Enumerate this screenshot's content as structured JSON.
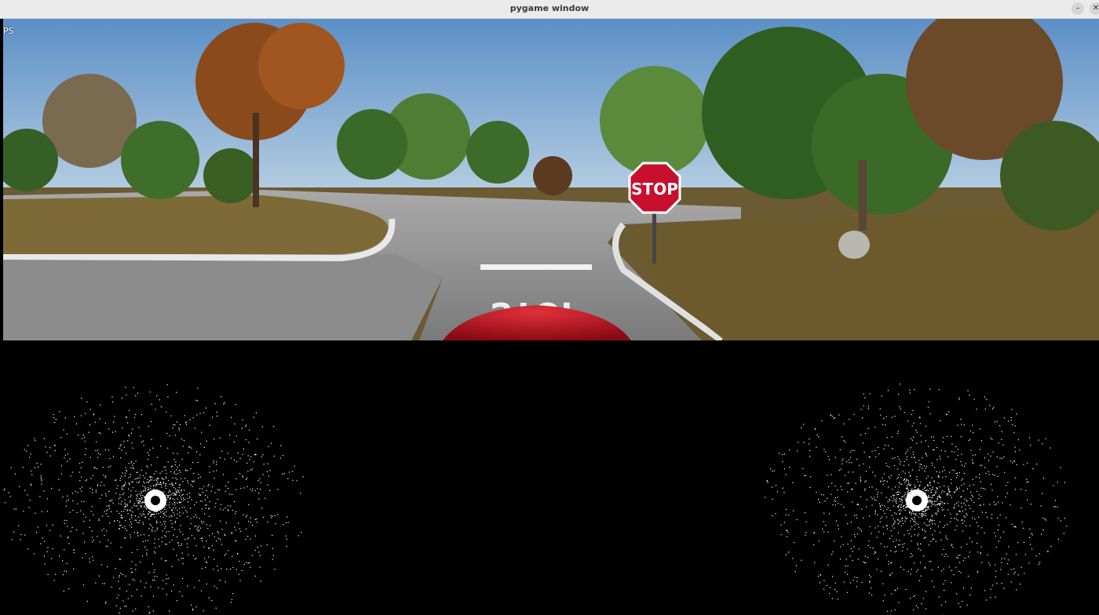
{
  "window": {
    "title": "pygame window",
    "minimize_symbol": "–",
    "close_symbol": "✕"
  },
  "camera": {
    "fps_text": "PS",
    "sign_text": "STOP",
    "road_marking_text": "STOP"
  },
  "icons": {
    "minimize": "minimize-icon",
    "close": "close-icon"
  },
  "colors": {
    "sky": "#6f9ccc",
    "stop_sign": "#c8102e",
    "car_hood": "#b3101c",
    "lidar_points": "#ffffff"
  }
}
